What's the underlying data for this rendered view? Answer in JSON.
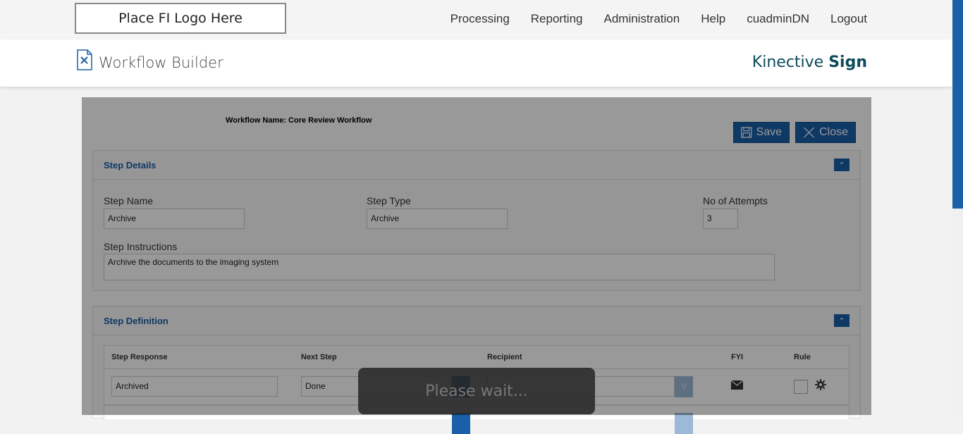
{
  "topbar": {
    "logo_text": "Place FI Logo Here",
    "nav": [
      "Processing",
      "Reporting",
      "Administration",
      "Help",
      "cuadminDN",
      "Logout"
    ]
  },
  "header": {
    "title": "Workflow Builder",
    "brand_light": "Kinective ",
    "brand_bold": "Sign"
  },
  "workflow": {
    "name_label": "Workflow Name: Core Review Workflow",
    "save_label": "Save",
    "close_label": "Close"
  },
  "step_details": {
    "title": "Step Details",
    "step_name_label": "Step Name",
    "step_name_value": "Archive",
    "step_type_label": "Step Type",
    "step_type_value": "Archive",
    "attempts_label": "No of Attempts",
    "attempts_value": "3",
    "instructions_label": "Step Instructions",
    "instructions_value": "Archive the documents to the imaging system"
  },
  "step_definition": {
    "title": "Step Definition",
    "columns": [
      "Step Response",
      "Next Step",
      "Recipient",
      "FYI",
      "Rule"
    ],
    "rows": [
      {
        "response": "Archived",
        "next_step": "Done",
        "recipient": ""
      }
    ]
  },
  "overlay": {
    "wait_text": "Please wait..."
  },
  "colors": {
    "accent": "#1a5fa8",
    "brand": "#0d4a5a"
  }
}
